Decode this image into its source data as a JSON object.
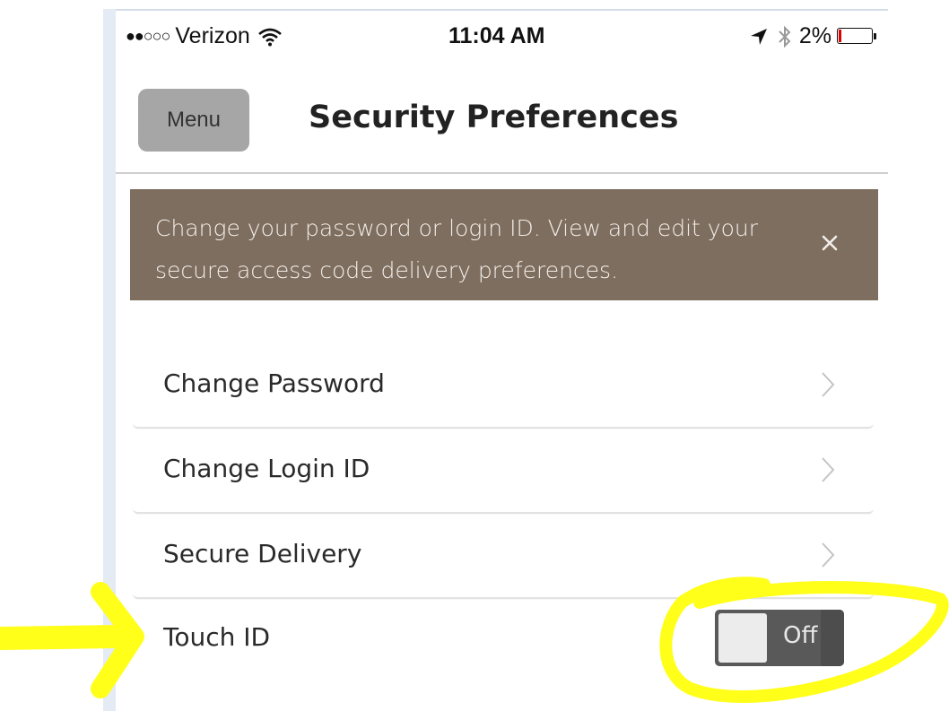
{
  "status_bar": {
    "signal": "●●○○○",
    "carrier": "Verizon",
    "time": "11:04 AM",
    "battery_percent": "2%",
    "battery_level": 0.02
  },
  "header": {
    "menu_label": "Menu",
    "title": "Security Preferences"
  },
  "banner": {
    "text": "Change your password or login ID. View and edit your secure access code delivery preferences."
  },
  "list": {
    "items": [
      {
        "label": "Change Password"
      },
      {
        "label": "Change Login ID"
      },
      {
        "label": "Secure Delivery"
      }
    ]
  },
  "touch_id": {
    "label": "Touch ID",
    "state": "Off"
  },
  "colors": {
    "banner": "#7e6e5f",
    "menu_button": "#a6a6a6",
    "switch_off": "#595959",
    "annotation": "#ffff1a"
  },
  "icons": [
    "wifi-icon",
    "location-arrow-icon",
    "bluetooth-icon",
    "battery-icon",
    "close-icon",
    "chevron-right-icon"
  ]
}
